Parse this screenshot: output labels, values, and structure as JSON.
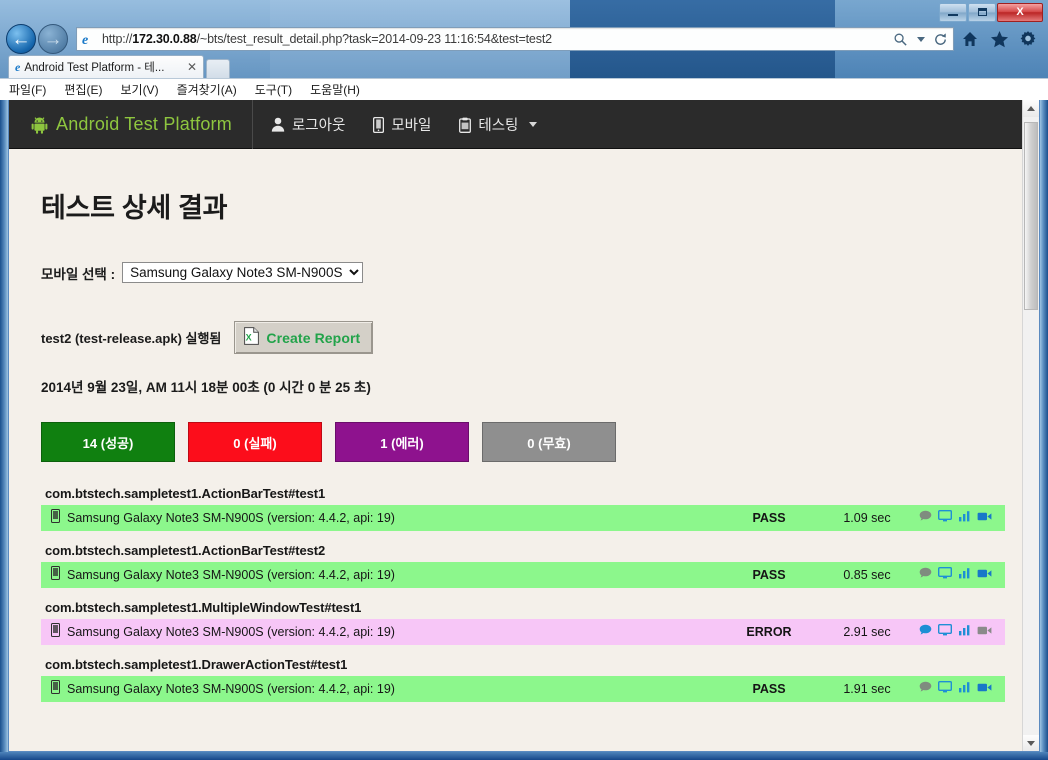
{
  "browser": {
    "url": "http://172.30.0.88/~bts/test_result_detail.php?task=2014-09-23 11:16:54&test=test2",
    "url_host": "172.30.0.88",
    "url_prefix": "http://",
    "url_suffix": "/~bts/test_result_detail.php?task=2014-09-23 11:16:54&test=test2",
    "tab_title": "Android Test Platform - 테...",
    "tab_close": "✕",
    "back_icon": "back-arrow-icon",
    "forward_icon": "forward-arrow-icon",
    "search_icon": "search-icon",
    "refresh_icon": "refresh-icon",
    "home_icon": "home-icon",
    "favorites_icon": "star-icon",
    "settings_icon": "gear-icon",
    "minimize_label": "Minimize",
    "maximize_label": "Maximize",
    "close_label": "X",
    "menu": [
      {
        "label": "파일(F)",
        "key": "F"
      },
      {
        "label": "편집(E)",
        "key": "E"
      },
      {
        "label": "보기(V)",
        "key": "V"
      },
      {
        "label": "즐겨찾기(A)",
        "key": "A"
      },
      {
        "label": "도구(T)",
        "key": "T"
      },
      {
        "label": "도움말(H)",
        "key": "H"
      }
    ]
  },
  "site": {
    "brand": "Android Test Platform",
    "brand_icon": "android-robot-icon",
    "nav": [
      {
        "label": "로그아웃",
        "icon": "user-icon",
        "caret": false
      },
      {
        "label": "모바일",
        "icon": "mobile-phone-icon",
        "caret": false
      },
      {
        "label": "테스팅",
        "icon": "clipboard-icon",
        "caret": true
      }
    ]
  },
  "main": {
    "page_title": "테스트 상세 결과",
    "mobile_select_label": "모바일 선택 :",
    "mobile_select_value": "Samsung Galaxy Note3 SM-N900S",
    "mobile_select_options": [
      "Samsung Galaxy Note3 SM-N900S"
    ],
    "apk_text": "test2 (test-release.apk) 실행됨",
    "create_report_label": "Create Report",
    "create_report_icon": "excel-file-icon",
    "timestamp": "2014년 9월 23일, AM 11시 18분 00초 (0 시간 0 분 25 초)",
    "status_buttons": [
      {
        "label": "14 (성공)",
        "kind": "pass",
        "color": "#108010"
      },
      {
        "label": "0 (실패)",
        "kind": "fail",
        "color": "#fc0d1b"
      },
      {
        "label": "1 (에러)",
        "kind": "error",
        "color": "#8e128e"
      },
      {
        "label": "0 (무효)",
        "kind": "invalid",
        "color": "#8f8f8f"
      }
    ],
    "results": [
      {
        "test_name": "com.btstech.sampletest1.ActionBarTest#test1",
        "device": "Samsung Galaxy Note3 SM-N900S (version: 4.4.2, api: 19)",
        "status": "PASS",
        "time": "1.09 sec",
        "row_kind": "pass",
        "icons": [
          "comment-icon",
          "screen-icon",
          "chart-icon",
          "video-icon"
        ]
      },
      {
        "test_name": "com.btstech.sampletest1.ActionBarTest#test2",
        "device": "Samsung Galaxy Note3 SM-N900S (version: 4.4.2, api: 19)",
        "status": "PASS",
        "time": "0.85 sec",
        "row_kind": "pass",
        "icons": [
          "comment-icon",
          "screen-icon",
          "chart-icon",
          "video-icon"
        ]
      },
      {
        "test_name": "com.btstech.sampletest1.MultipleWindowTest#test1",
        "device": "Samsung Galaxy Note3 SM-N900S (version: 4.4.2, api: 19)",
        "status": "ERROR",
        "time": "2.91 sec",
        "row_kind": "error",
        "icons": [
          "comment-icon",
          "screen-icon",
          "chart-icon",
          "video-icon"
        ]
      },
      {
        "test_name": "com.btstech.sampletest1.DrawerActionTest#test1",
        "device": "Samsung Galaxy Note3 SM-N900S (version: 4.4.2, api: 19)",
        "status": "PASS",
        "time": "1.91 sec",
        "row_kind": "pass",
        "icons": [
          "comment-icon",
          "screen-icon",
          "chart-icon",
          "video-icon"
        ]
      }
    ],
    "device_icon": "mobile-device-icon"
  },
  "scrollbar": {
    "up_label": "scroll-up",
    "down_label": "scroll-down"
  }
}
